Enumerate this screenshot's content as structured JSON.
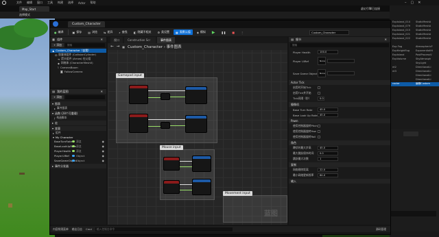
{
  "editor": {
    "menu": [
      "文件",
      "编辑",
      "窗口",
      "工具",
      "构建",
      "选择",
      "Actor",
      "帮助"
    ],
    "level_tab": "Map_Start",
    "save_button": "选择模式",
    "right_user": "虚幻引擎已连接",
    "outliner_items": [
      "ExpIsland_014",
      "ExpIsland_079",
      "ExpIsland_015",
      "ExpIsland_021",
      "ExpIsland_022",
      "",
      "Exp Fog",
      "ExpHeightFog",
      "ExpIsland",
      "ExpVolume",
      "",
      "nt2",
      "nt3",
      "",
      "",
      "racter"
    ],
    "outliner_types": [
      "StaticMeshA",
      "StaticMeshA",
      "StaticMeshA",
      "StaticMeshA",
      "StaticMeshA",
      "",
      "AtmosphericF",
      "ExponentialHi",
      "PostProcessV",
      "SkyAtmosph",
      "SkyLight",
      "DirectionalLi",
      "DirectionalLi",
      "DirectionalLi",
      "DirectionalLi",
      "编辑Custom"
    ]
  },
  "blueprint": {
    "tab_title": "Custom_Character",
    "toolbar": {
      "compile": "编译",
      "save": "保存",
      "browse": "浏览",
      "diff": "差异",
      "find": "查找",
      "hide_unrelated": "隐藏不相关",
      "class_settings": "类设置",
      "class_defaults": "类默认值",
      "simulate": "模拟",
      "debug_target": "Custom_Character"
    },
    "components_panel": {
      "title": "组件",
      "add_button": "+ 添加",
      "search_placeholder": "搜索",
      "tree": [
        "Custom_Character（自我）",
        "胶囊体组件 (CollisionCylinder)",
        "箭头组件 (Arrow) 在父组",
        "网格体 (CharacterMesh0)",
        "CameraBoom",
        "FollowCamera"
      ]
    },
    "my_blueprint": {
      "title": "我的蓝图",
      "add_button": "+ 添加",
      "sections": {
        "graphs": "图表",
        "event_graph": "事件图表",
        "functions": "函数 (28个可重载)",
        "construction": "构造脚本",
        "macros": "宏",
        "variables": "变量",
        "components": "组件",
        "my_character": "My Character",
        "event_dispatchers": "事件分发器"
      },
      "variables": [
        {
          "name": "BaseTurnRate",
          "type": "浮点",
          "color": "#9be26a"
        },
        {
          "name": "BaseLookUpRate",
          "type": "浮点",
          "color": "#9be26a"
        },
        {
          "name": "PlayerHealth",
          "type": "浮点",
          "color": "#9be26a"
        },
        {
          "name": "PlayerUiRef",
          "type": "Object",
          "color": "#3aa6ff"
        },
        {
          "name": "SaveGameObject",
          "type": "Object",
          "color": "#3aa6ff"
        }
      ]
    },
    "graph": {
      "tabs": [
        "视口",
        "Construction Scr",
        "事件图表"
      ],
      "breadcrumb": "Custom_Character › 事件图表",
      "watermark": "蓝图",
      "comments": [
        {
          "title": "Gamepad input"
        },
        {
          "title": "Mouse input"
        },
        {
          "title": "Movement input"
        }
      ]
    },
    "details": {
      "title": "细节",
      "search_placeholder": "搜索",
      "rows_top": [
        {
          "label": "Player Health",
          "value": "100.0"
        },
        {
          "label": "Player UiRef",
          "value": "None"
        },
        {
          "label": "Save Game Object",
          "value": "None"
        }
      ],
      "actor_tick": "Actor Tick",
      "tick_rows": [
        {
          "label": "启用时开始Tick"
        },
        {
          "label": "启用Tick并开始"
        },
        {
          "label": "Tick间隔（秒）",
          "value": "0.0"
        }
      ],
      "camera": "摄像机",
      "camera_rows": [
        {
          "label": "Base Turn Rate",
          "value": "45.0"
        },
        {
          "label": "Base Look Up Rate",
          "value": "45.0"
        }
      ],
      "pawn": "Pawn",
      "pawn_rows": [
        {
          "label": "使用控制器旋转Pitch"
        },
        {
          "label": "使用控制器旋转Yaw"
        },
        {
          "label": "使用控制器旋转Roll"
        }
      ],
      "character": "角色",
      "character_rows": [
        {
          "label": "蹲伏时最大步高",
          "value": "45.0"
        },
        {
          "label": "最大跳跃保持时间",
          "value": "0.0"
        },
        {
          "label": "跳跃最大次数",
          "value": "1"
        }
      ],
      "replication": "复制",
      "rep_rows": [
        {
          "label": "网络剔除距离",
          "value": "22.0"
        },
        {
          "label": "最小网络更新频率",
          "value": "64.0"
        }
      ],
      "input": "输入"
    },
    "bottom": {
      "content_drawer": "内容侧滑菜单",
      "output_log": "输出日志",
      "cmd": "Cmd",
      "cmd_placeholder": "输入控制台命令",
      "source_control": "源码管理"
    }
  }
}
